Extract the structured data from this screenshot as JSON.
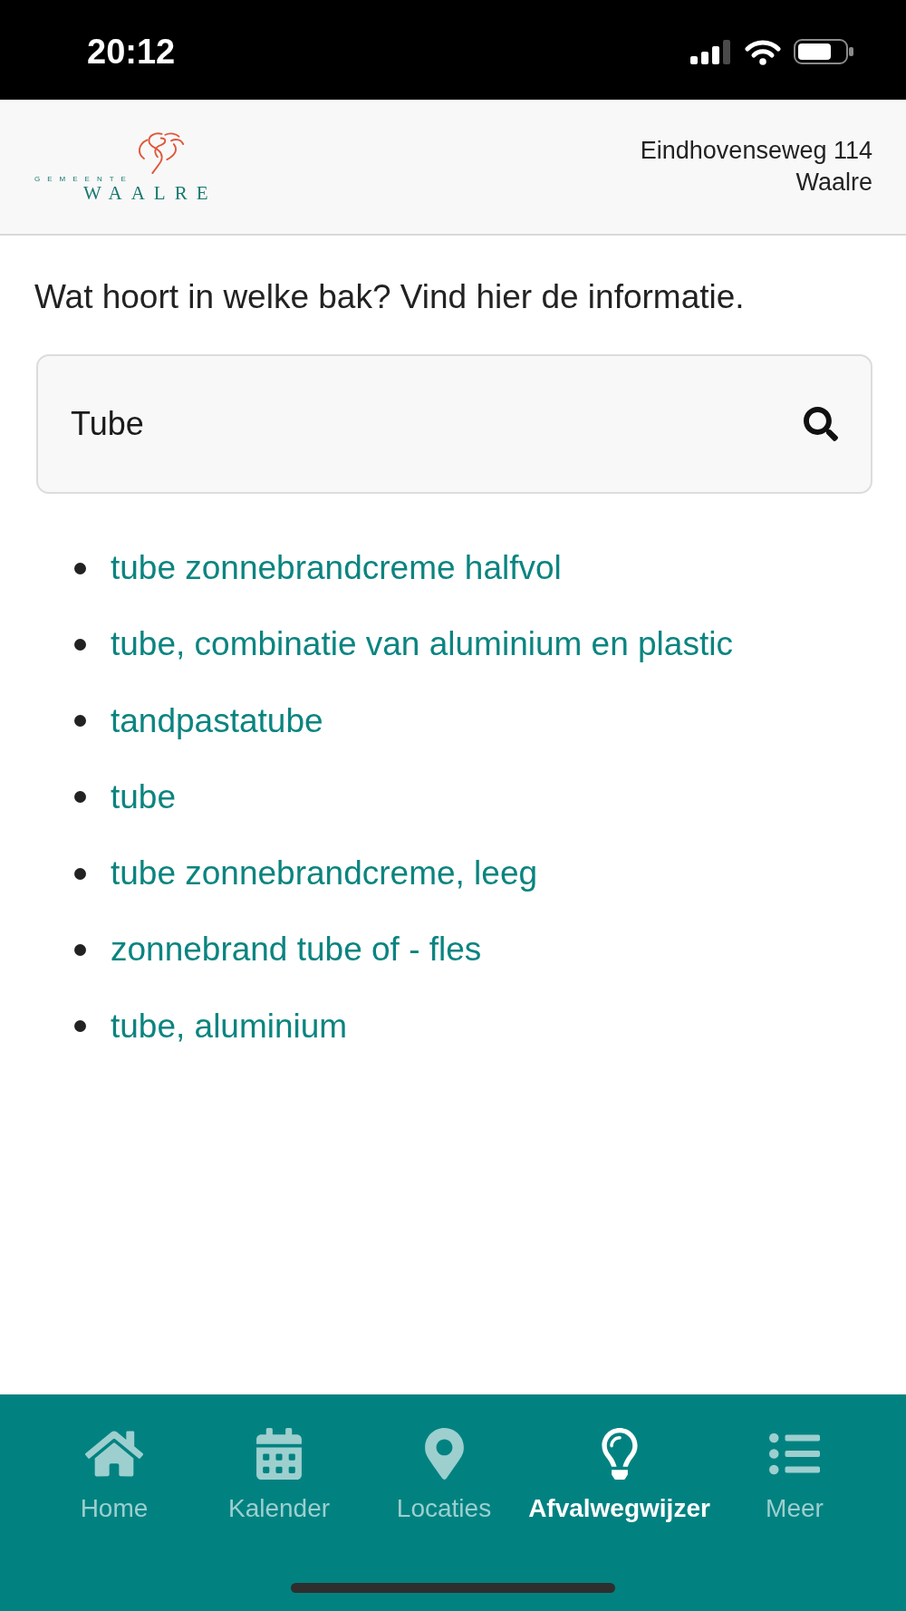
{
  "status_bar": {
    "time": "20:12"
  },
  "header": {
    "logo": {
      "small_text": "GEMEENTE",
      "name": "WAALRE"
    },
    "address": [
      "Eindhovenseweg 114",
      "Waalre"
    ]
  },
  "intro": "Wat hoort in welke bak? Vind hier de informatie.",
  "search": {
    "value": "Tube"
  },
  "results": [
    "tube zonnebrandcreme halfvol",
    "tube, combinatie van aluminium en plastic",
    "tandpastatube",
    "tube",
    "tube zonnebrandcreme, leeg",
    "zonnebrand tube of - fles",
    "tube, aluminium"
  ],
  "nav": {
    "items": [
      {
        "label": "Home",
        "selected": false
      },
      {
        "label": "Kalender",
        "selected": false
      },
      {
        "label": "Locaties",
        "selected": false
      },
      {
        "label": "Afvalwegwijzer",
        "selected": true
      },
      {
        "label": "Meer",
        "selected": false
      }
    ]
  }
}
